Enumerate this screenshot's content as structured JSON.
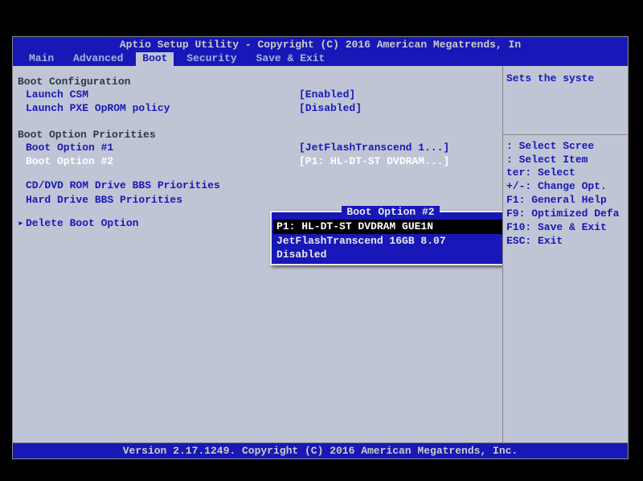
{
  "title": "Aptio Setup Utility - Copyright (C) 2016 American Megatrends, In",
  "tabs": [
    {
      "label": "Main"
    },
    {
      "label": "Advanced"
    },
    {
      "label": "Boot"
    },
    {
      "label": "Security"
    },
    {
      "label": "Save & Exit"
    }
  ],
  "active_tab": "Boot",
  "sections": {
    "boot_config": {
      "title": "Boot Configuration",
      "items": [
        {
          "label": "Launch CSM",
          "value": "[Enabled]"
        },
        {
          "label": "Launch PXE OpROM policy",
          "value": "[Disabled]"
        }
      ]
    },
    "boot_priorities": {
      "title": "Boot Option Priorities",
      "items": [
        {
          "label": "Boot Option #1",
          "value": "[JetFlashTranscend 1...]"
        },
        {
          "label": "Boot Option #2",
          "value": "[P1: HL-DT-ST DVDRAM...]"
        }
      ]
    },
    "bbs": {
      "items": [
        {
          "label": "CD/DVD ROM Drive BBS Priorities"
        },
        {
          "label": "Hard Drive BBS Priorities"
        }
      ]
    },
    "delete": {
      "label": "Delete Boot Option"
    }
  },
  "popup": {
    "title": "Boot Option #2",
    "items": [
      {
        "label": "P1: HL-DT-ST DVDRAM GUE1N",
        "highlighted": true
      },
      {
        "label": "JetFlashTranscend 16GB 8.07",
        "highlighted": false
      },
      {
        "label": "Disabled",
        "highlighted": false
      }
    ]
  },
  "help_top": "Sets the syste",
  "help_keys": [
    ": Select Scree",
    ": Select Item",
    "ter: Select",
    "+/-: Change Opt.",
    "F1: General Help",
    "F9: Optimized Defa",
    "F10: Save & Exit",
    "ESC: Exit"
  ],
  "footer": "Version 2.17.1249. Copyright (C) 2016 American Megatrends, Inc."
}
